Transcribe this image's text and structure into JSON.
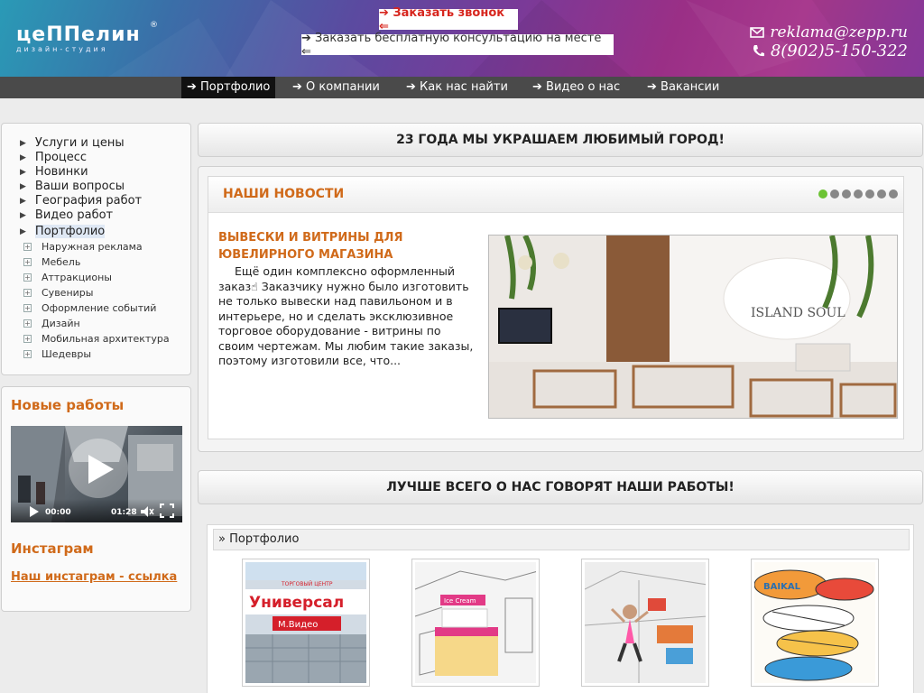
{
  "header": {
    "logo_text": "цеППелин",
    "logo_sub": "дизайн-студия",
    "logo_reg": "®",
    "call_button": "➔ Заказать звонок ⇐",
    "consult_button": "➔ Заказать бесплатную консультацию на месте ⇐",
    "email": "reklama@zepp.ru",
    "phone": "8(902)5-150-322"
  },
  "topnav": {
    "items": [
      {
        "label": "➔ Портфолио"
      },
      {
        "label": "➔ О компании"
      },
      {
        "label": "➔ Как нас найти"
      },
      {
        "label": "➔ Видео о нас"
      },
      {
        "label": "➔ Вакансии"
      }
    ]
  },
  "sidebar": {
    "menu": [
      {
        "label": "Услуги и цены"
      },
      {
        "label": "Процесс"
      },
      {
        "label": "Новинки"
      },
      {
        "label": "Ваши вопросы"
      },
      {
        "label": "География работ"
      },
      {
        "label": "Видео работ"
      },
      {
        "label": "Портфолио"
      }
    ],
    "submenu": [
      {
        "label": "Наружная реклама"
      },
      {
        "label": "Мебель"
      },
      {
        "label": "Аттракционы"
      },
      {
        "label": "Сувениры"
      },
      {
        "label": "Оформление событий"
      },
      {
        "label": "Дизайн"
      },
      {
        "label": "Мобильная архитектура"
      },
      {
        "label": "Шедевры"
      }
    ],
    "works_title": "Новые работы",
    "video_time_current": "00:00",
    "video_time_total": "01:28",
    "instagram_title": "Инстаграм",
    "instagram_link": "Наш инстаграм - ссылка"
  },
  "main": {
    "banner_top": "23 ГОДА МЫ УКРАШАЕМ ЛЮБИМЫЙ ГОРОД!",
    "news_title": "НАШИ НОВОСТИ",
    "article_title": "ВЫВЕСКИ И ВИТРИНЫ ДЛЯ ЮВЕЛИРНОГО МАГАЗИНА",
    "article_body": "Ещё один комплексно оформленный заказ☝   Заказчику нужно было изготовить не только вывески над павильоном и в интерьере, но и сделать эксклюзивное торговое оборудование - витрины по своим чертежам.    Мы любим такие заказы, поэтому изготовили все, что...",
    "image_sign": "ISLAND SOUL",
    "banner_works": "ЛУЧШЕ ВСЕГО О НАС ГОВОРЯТ НАШИ РАБОТЫ!",
    "portfolio_head": "» Портфолио",
    "thumb_texts": {
      "universal": "Универсал",
      "mvideo": "М.Видео",
      "tc": "ТОРГОВЫЙ ЦЕНТР",
      "ice_cream": "Ice Cream",
      "baikal": "BAIKAL"
    }
  },
  "colors": {
    "accent": "#d06a1a",
    "nav_bg": "#4a4a4a",
    "call_red": "#d7261e"
  }
}
